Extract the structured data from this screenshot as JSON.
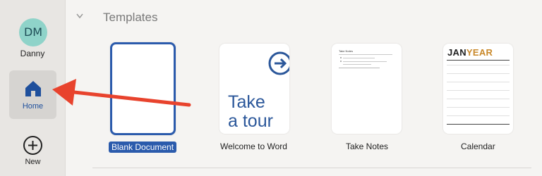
{
  "sidebar": {
    "avatar_initials": "DM",
    "user_name": "Danny",
    "home_label": "Home",
    "new_label": "New"
  },
  "main": {
    "section_title": "Templates",
    "templates": [
      {
        "label": "Blank Document",
        "selected": true
      },
      {
        "label": "Welcome to Word",
        "thumbnail_text": "Take a tour"
      },
      {
        "label": "Take Notes",
        "thumbnail_title": "Take Notes"
      },
      {
        "label": "Calendar",
        "thumbnail_title_part1": "JAN",
        "thumbnail_title_part2": "YEAR"
      }
    ]
  },
  "colors": {
    "accent": "#2b5bac",
    "annotation_arrow": "#e8432d",
    "avatar": "#8fd3c9"
  }
}
